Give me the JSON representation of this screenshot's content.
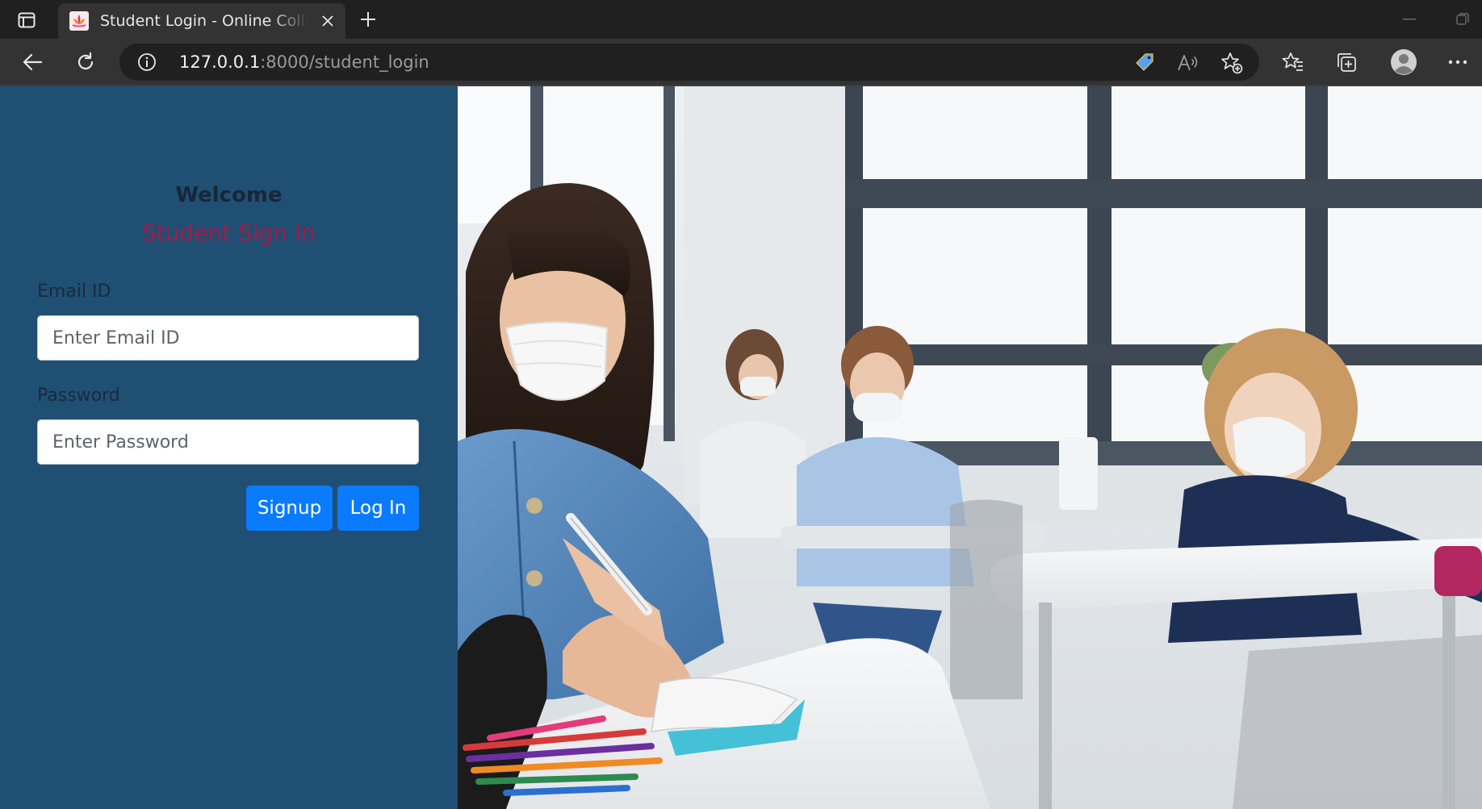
{
  "browser": {
    "tab": {
      "title": "Student Login - Online College Admission",
      "favicon": "lotus-icon",
      "close_icon": "close-icon"
    },
    "new_tab_icon": "plus-icon",
    "address": {
      "host": "127.0.0.1",
      "rest": ":8000/student_login",
      "info_icon": "info-icon"
    },
    "toolbar_icons": [
      "back-arrow-icon",
      "refresh-icon",
      "coupon-tag-icon",
      "read-aloud-icon",
      "add-favorite-icon",
      "favorites-icon",
      "collections-icon",
      "profile-icon",
      "more-icon"
    ]
  },
  "login": {
    "welcome": "Welcome",
    "heading": "Student Sign In",
    "email_label": "Email ID",
    "email_placeholder": "Enter Email ID",
    "password_label": "Password",
    "password_placeholder": "Enter Password",
    "signup_button": "Signup",
    "login_button": "Log In"
  },
  "colors": {
    "panel_bg": "#204f74",
    "heading_red": "#a01d48",
    "button_blue": "#0a7bff",
    "chrome_dark": "#202020",
    "chrome_mid": "#333333"
  },
  "hero_image": {
    "icon": "classroom-photo"
  }
}
